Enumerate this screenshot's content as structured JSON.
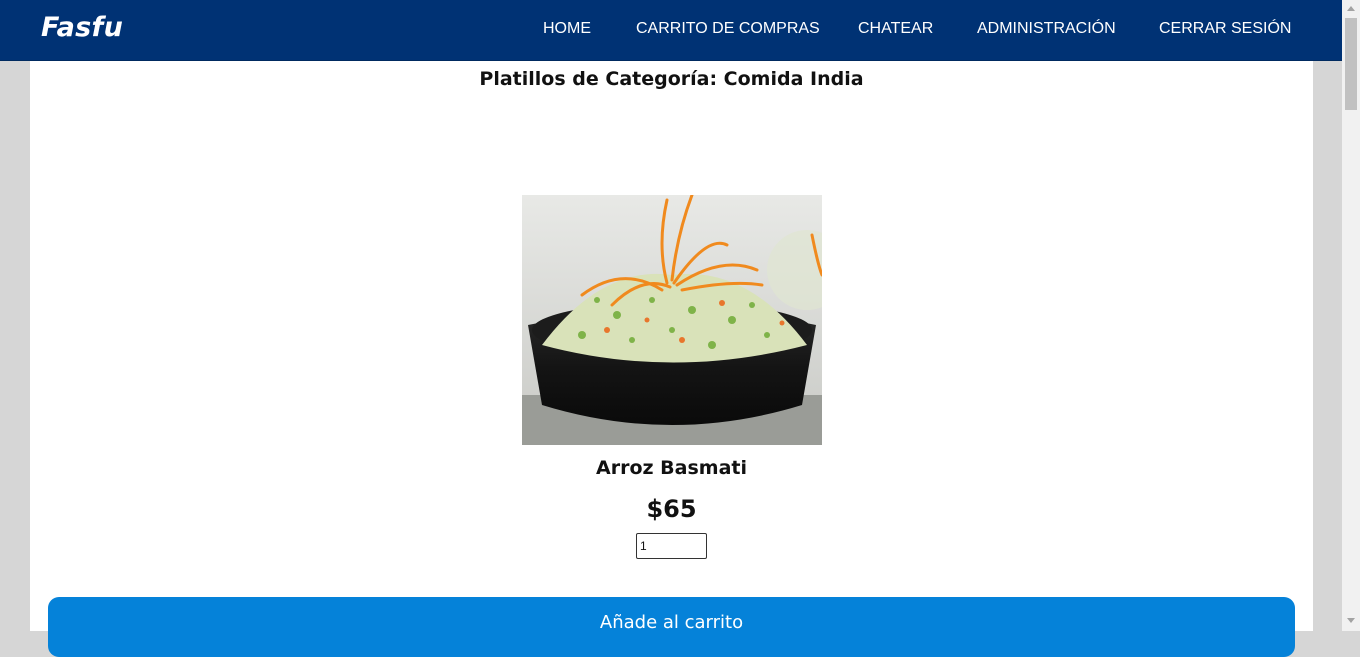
{
  "navbar": {
    "logo": "Fasfu",
    "links": [
      "HOME",
      "CARRITO DE COMPRAS",
      "CHATEAR",
      "ADMINISTRACIÓN",
      "CERRAR SESIÓN"
    ],
    "background": "#003274"
  },
  "main": {
    "title": "Platillos de Categoría: Comida India",
    "product": {
      "name": "Arroz Basmati",
      "price": "$65",
      "quantity": "1",
      "image": "rice-salad-bowl"
    },
    "add_button_label": "Añade al carrito",
    "button_color": "#0582d9"
  }
}
